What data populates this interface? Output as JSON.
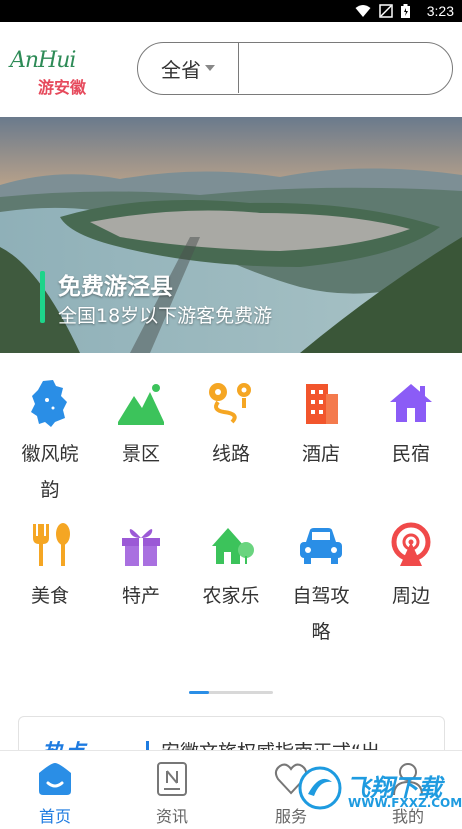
{
  "status_bar": {
    "time": "3:23",
    "icons": [
      "wifi-icon",
      "no-sim-icon",
      "battery-icon"
    ]
  },
  "header": {
    "logo_script": "AnHui",
    "logo_text": "游安徽",
    "region": "全省",
    "search_value": "",
    "search_placeholder": ""
  },
  "banner": {
    "title": "免费游泾县",
    "subtitle": "全国18岁以下游客免费游",
    "accent": "#1dd48a"
  },
  "categories": [
    {
      "label": "徽风皖韵",
      "icon": "anhui-map-icon",
      "color": "#2a8ee6"
    },
    {
      "label": "景区",
      "icon": "mountain-icon",
      "color": "#3cc35b"
    },
    {
      "label": "线路",
      "icon": "route-icon",
      "color": "#f5a623"
    },
    {
      "label": "酒店",
      "icon": "hotel-building-icon",
      "color": "#f2552c"
    },
    {
      "label": "民宿",
      "icon": "house-icon",
      "color": "#8b5cf6"
    },
    {
      "label": "美食",
      "icon": "fork-spoon-icon",
      "color": "#f5a623"
    },
    {
      "label": "特产",
      "icon": "gift-icon",
      "color": "#9b59d6"
    },
    {
      "label": "农家乐",
      "icon": "farmhouse-icon",
      "color": "#3cc35b"
    },
    {
      "label": "自驾攻略",
      "icon": "car-icon",
      "color": "#2a8ee6"
    },
    {
      "label": "周边",
      "icon": "ferris-wheel-icon",
      "color": "#f04a4a"
    }
  ],
  "news": {
    "tag": "热点",
    "text": "安徽文旅权威指南正式“出"
  },
  "bottom_nav": [
    {
      "label": "首页",
      "icon": "home-icon",
      "active": true
    },
    {
      "label": "资讯",
      "icon": "news-icon",
      "active": false
    },
    {
      "label": "服务",
      "icon": "service-icon",
      "active": false
    },
    {
      "label": "我的",
      "icon": "user-icon",
      "active": false
    }
  ],
  "watermark": {
    "text": "飞翔下载",
    "url": "WWW.FXXZ.COM"
  },
  "colors": {
    "brand_blue": "#1e7be0",
    "text": "#333333",
    "divider": "#e6e6e6"
  }
}
